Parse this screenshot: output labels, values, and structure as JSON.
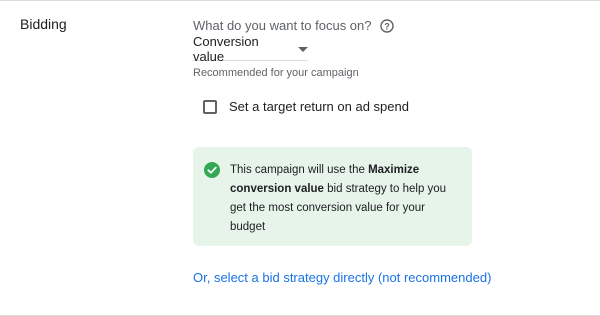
{
  "section": {
    "label": "Bidding"
  },
  "focus": {
    "question": "What do you want to focus on?",
    "help_icon": "help-circle-icon",
    "selected": "Conversion value",
    "dropdown_icon": "caret-down-icon",
    "recommendation": "Recommended for your campaign"
  },
  "target_roas": {
    "checked": false,
    "label": "Set a target return on ad spend"
  },
  "info": {
    "icon": "check-circle-icon",
    "text_before": "This campaign will use the ",
    "strategy": "Maximize conversion value",
    "text_after": " bid strategy to help you get the most conversion value for your budget",
    "background_color": "#e6f4ea",
    "icon_color": "#34a853"
  },
  "link": {
    "label": "Or, select a bid strategy directly (not recommended)",
    "color": "#1a73e8"
  }
}
